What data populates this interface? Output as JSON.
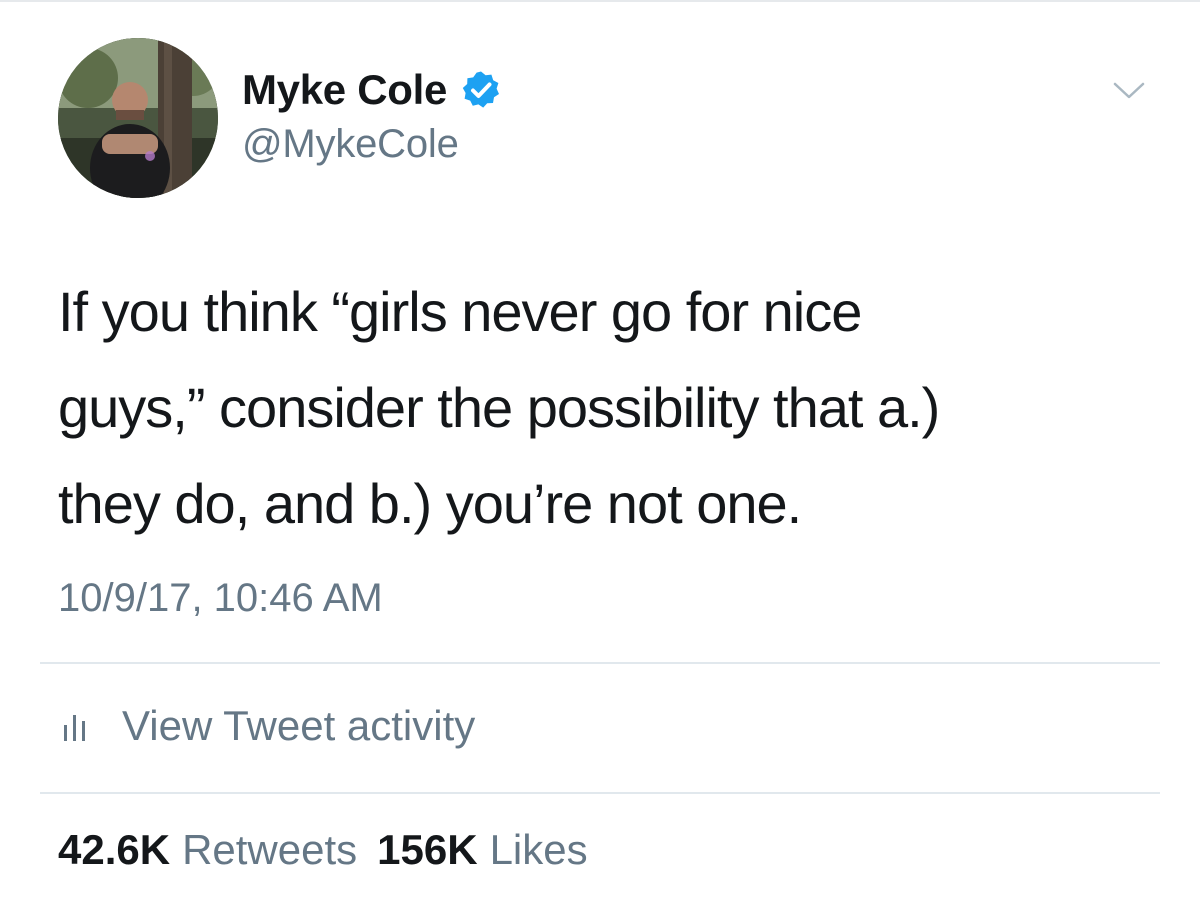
{
  "tweet": {
    "author": {
      "display_name": "Myke Cole",
      "handle": "@MykeCole",
      "verified": true,
      "avatar_icon": "profile-photo"
    },
    "text_lines": [
      "If you think “girls never go for nice",
      "guys,” consider the possibility that a.)",
      "they do, and b.) you’re not one."
    ],
    "timestamp": "10/9/17, 10:46 AM",
    "activity": {
      "label": "View Tweet activity",
      "icon": "analytics-bars-icon"
    },
    "stats": {
      "retweets_count": "42.6K",
      "retweets_label": "Retweets",
      "likes_count": "156K",
      "likes_label": "Likes"
    },
    "menu_icon": "chevron-down-icon"
  },
  "colors": {
    "text_primary": "#14171a",
    "text_secondary": "#657786",
    "verified_blue": "#1da1f2",
    "divider": "#e1e8ed"
  }
}
